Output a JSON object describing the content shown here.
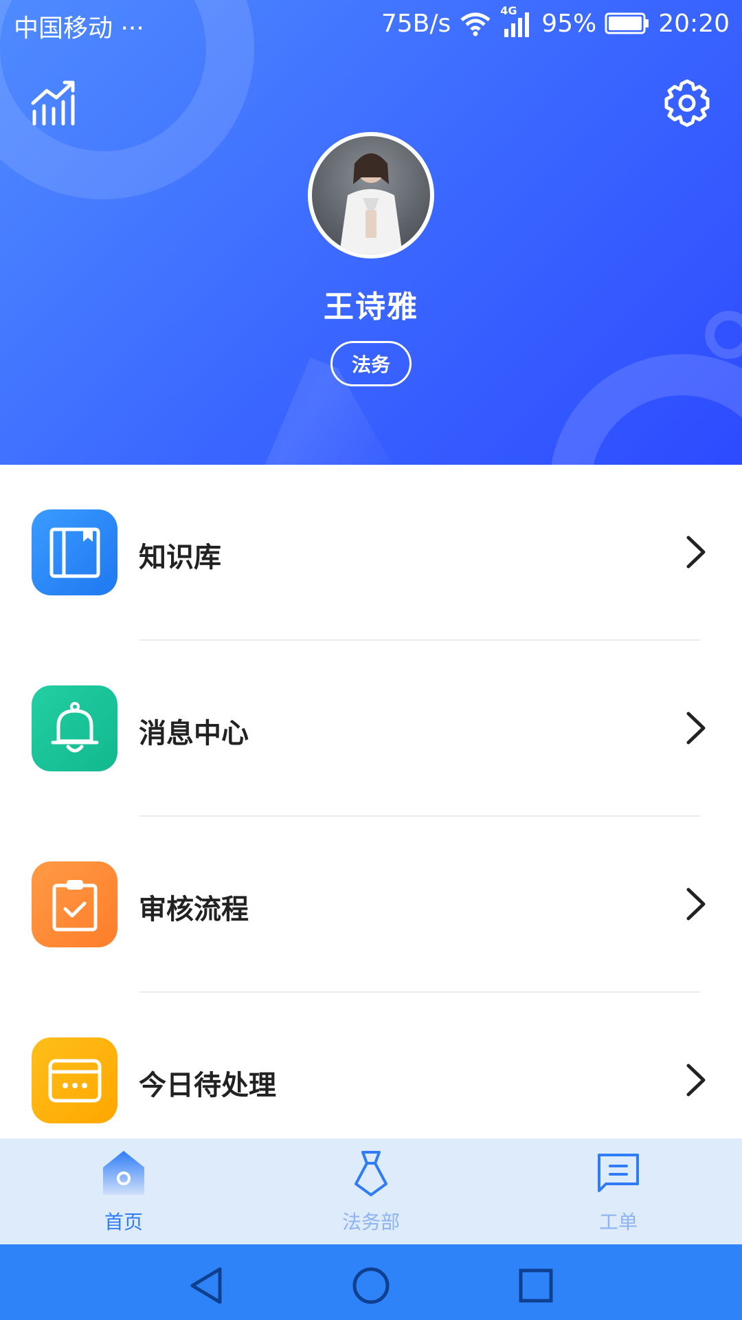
{
  "status_bar": {
    "carrier": "中国移动 ···",
    "speed": "75B/s",
    "network": "4G",
    "battery": "95%",
    "time": "20:20"
  },
  "header": {
    "left_icon": "stats-chart-icon",
    "right_icon": "gear-icon",
    "user_name": "王诗雅",
    "role": "法务"
  },
  "menu": [
    {
      "label": "知识库",
      "icon": "book-icon",
      "color": "#2b86f7"
    },
    {
      "label": "消息中心",
      "icon": "bell-icon",
      "color": "#1bc39a"
    },
    {
      "label": "审核流程",
      "icon": "clipboard-check-icon",
      "color": "#ff8c35"
    },
    {
      "label": "今日待处理",
      "icon": "card-dots-icon",
      "color": "#ffb000"
    }
  ],
  "tabs": [
    {
      "label": "首页",
      "icon": "home-icon",
      "active": true,
      "color": "#2f7cf6"
    },
    {
      "label": "法务部",
      "icon": "tie-icon",
      "active": false,
      "color": "#8db3f2"
    },
    {
      "label": "工单",
      "icon": "message-icon",
      "active": false,
      "color": "#8db3f2"
    }
  ],
  "colors": {
    "header_gradient_start": "#4f8bff",
    "header_gradient_end": "#2d4bff",
    "tabbar_bg": "#deebfb",
    "navbar_bg": "#2f83f8"
  }
}
